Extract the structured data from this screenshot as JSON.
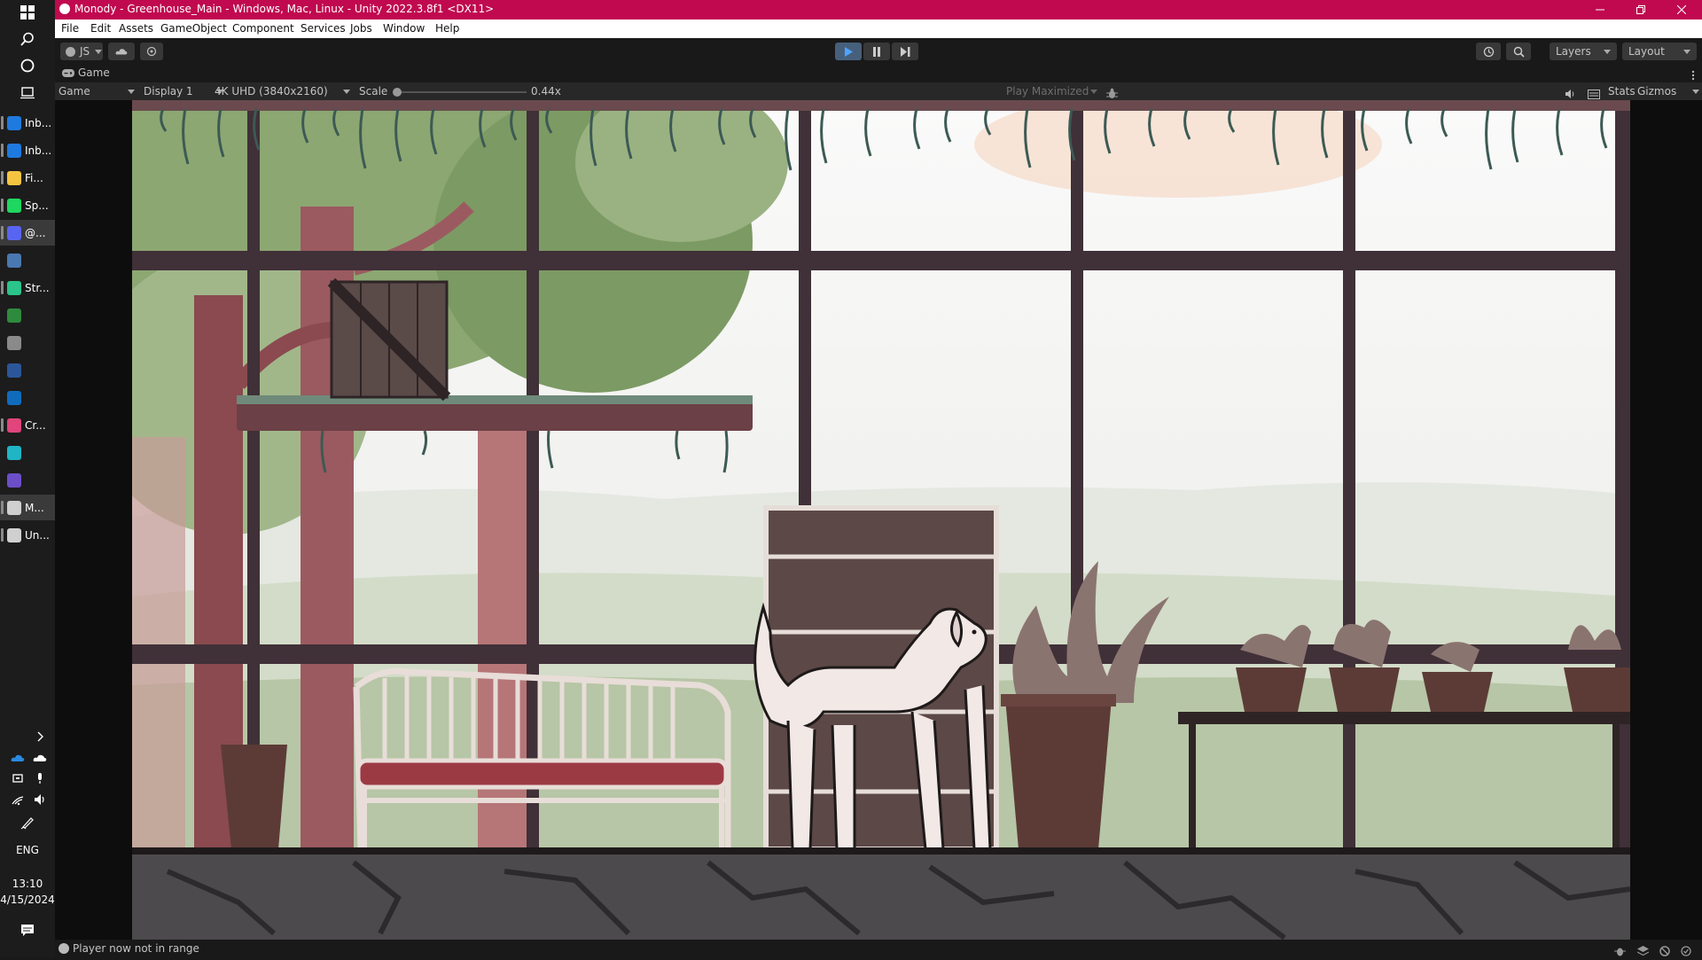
{
  "window": {
    "title": "Monody - Greenhouse_Main - Windows, Mac, Linux - Unity 2022.3.8f1 <DX11>",
    "accent_color": "#c0094f",
    "controls": [
      "minimize-icon",
      "restore-icon",
      "close-icon"
    ]
  },
  "menu": {
    "items": [
      "File",
      "Edit",
      "Assets",
      "GameObject",
      "Component",
      "Services",
      "Jobs",
      "Window",
      "Help"
    ]
  },
  "toolbar": {
    "account_label": "JS",
    "play_icon": "play-icon",
    "pause_icon": "pause-icon",
    "step_icon": "step-icon",
    "layers_label": "Layers",
    "layout_label": "Layout"
  },
  "game_view": {
    "tab_label": "Game",
    "view_select": "Game",
    "display_select": "Display 1",
    "resolution_select": "4K UHD (3840x2160)",
    "scale_label": "Scale",
    "scale_value": "0.44x",
    "scale_fraction": 0.0,
    "play_mode_select": "Play Maximized",
    "stats_label": "Stats",
    "gizmos_label": "Gizmos"
  },
  "status": {
    "message": "Player now not in range"
  },
  "taskbar": {
    "system_icons": [
      "windows-start-icon",
      "search-icon",
      "cortana-icon",
      "task-view-icon"
    ],
    "apps": [
      {
        "label": "Inb...",
        "color": "#1f7ae0",
        "icon": "edge-icon",
        "open": true,
        "active": false
      },
      {
        "label": "Inb...",
        "color": "#1f7ae0",
        "icon": "edge-icon",
        "open": true,
        "active": false
      },
      {
        "label": "Fi...",
        "color": "#f5c542",
        "icon": "folder-icon",
        "open": true,
        "active": false
      },
      {
        "label": "Sp...",
        "color": "#1ed760",
        "icon": "spotify-icon",
        "open": true,
        "active": false
      },
      {
        "label": "@...",
        "color": "#5865f2",
        "icon": "discord-icon",
        "open": true,
        "active": true
      },
      {
        "label": "",
        "color": "#4a78b0",
        "icon": "steam-icon",
        "open": false,
        "active": false
      },
      {
        "label": "Str...",
        "color": "#2bc48a",
        "icon": "streamlabs-icon",
        "open": true,
        "active": false
      },
      {
        "label": "",
        "color": "#2e8b3e",
        "icon": "xbox-icon",
        "open": false,
        "active": false
      },
      {
        "label": "",
        "color": "#8a8a8a",
        "icon": "epic-games-icon",
        "open": false,
        "active": false
      },
      {
        "label": "",
        "color": "#2b579a",
        "icon": "word-icon",
        "open": false,
        "active": false
      },
      {
        "label": "",
        "color": "#0f6cbd",
        "icon": "app-icon",
        "open": false,
        "active": false
      },
      {
        "label": "Cr...",
        "color": "#e0457b",
        "icon": "creative-cloud-icon",
        "open": true,
        "active": false
      },
      {
        "label": "",
        "color": "#1fb5c4",
        "icon": "live-icon",
        "open": false,
        "active": false
      },
      {
        "label": "",
        "color": "#6c4ec9",
        "icon": "github-icon",
        "open": false,
        "active": false
      },
      {
        "label": "M...",
        "color": "#d0d0d0",
        "icon": "unity-icon",
        "open": true,
        "active": true
      },
      {
        "label": "Un...",
        "color": "#d0d0d0",
        "icon": "unity-hub-icon",
        "open": true,
        "active": false
      }
    ],
    "language": "ENG",
    "time": "13:10",
    "date": "4/15/2024"
  }
}
